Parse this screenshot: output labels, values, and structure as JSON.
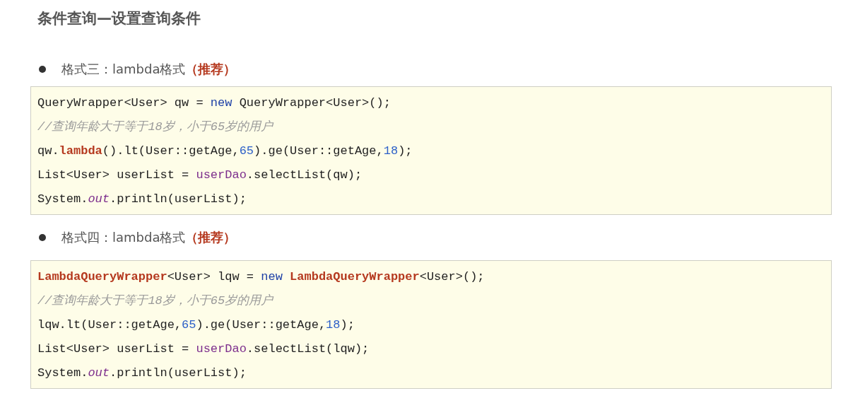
{
  "title": "条件查询—设置查询条件",
  "sections": [
    {
      "heading": "格式三：lambda格式**（推荐）**",
      "code": [
        [
          {
            "kind": "plain",
            "text": "QueryWrapper<User> qw = "
          },
          {
            "kind": "keyword",
            "text": "new"
          },
          {
            "kind": "plain",
            "text": " QueryWrapper<User>();"
          }
        ],
        [
          {
            "kind": "comment",
            "text": "//查询年龄大于等于18岁，小于65岁的用户"
          }
        ],
        [
          {
            "kind": "plain",
            "text": "qw."
          },
          {
            "kind": "type",
            "text": "lambda"
          },
          {
            "kind": "plain",
            "text": "().lt(User::getAge,"
          },
          {
            "kind": "number",
            "text": "65"
          },
          {
            "kind": "plain",
            "text": ").ge(User::getAge,"
          },
          {
            "kind": "number",
            "text": "18"
          },
          {
            "kind": "plain",
            "text": ");"
          }
        ],
        [
          {
            "kind": "plain",
            "text": "List<User> userList = "
          },
          {
            "kind": "field",
            "text": "userDao"
          },
          {
            "kind": "plain",
            "text": ".selectList(qw);"
          }
        ],
        [
          {
            "kind": "plain",
            "text": "System."
          },
          {
            "kind": "static",
            "text": "out"
          },
          {
            "kind": "plain",
            "text": ".println(userList);"
          }
        ]
      ]
    },
    {
      "heading": "格式四：lambda格式**（推荐）**",
      "code": [
        [
          {
            "kind": "type",
            "text": "LambdaQueryWrapper"
          },
          {
            "kind": "plain",
            "text": "<User> lqw = "
          },
          {
            "kind": "keyword",
            "text": "new "
          },
          {
            "kind": "type",
            "text": "LambdaQueryWrapper"
          },
          {
            "kind": "plain",
            "text": "<User>();"
          }
        ],
        [
          {
            "kind": "comment",
            "text": "//查询年龄大于等于18岁，小于65岁的用户"
          }
        ],
        [
          {
            "kind": "plain",
            "text": "lqw.lt(User::getAge,"
          },
          {
            "kind": "number",
            "text": "65"
          },
          {
            "kind": "plain",
            "text": ").ge(User::getAge,"
          },
          {
            "kind": "number",
            "text": "18"
          },
          {
            "kind": "plain",
            "text": ");"
          }
        ],
        [
          {
            "kind": "plain",
            "text": "List<User> userList = "
          },
          {
            "kind": "field",
            "text": "userDao"
          },
          {
            "kind": "plain",
            "text": ".selectList(lqw);"
          }
        ],
        [
          {
            "kind": "plain",
            "text": "System."
          },
          {
            "kind": "static",
            "text": "out"
          },
          {
            "kind": "plain",
            "text": ".println(userList);"
          }
        ]
      ]
    }
  ]
}
